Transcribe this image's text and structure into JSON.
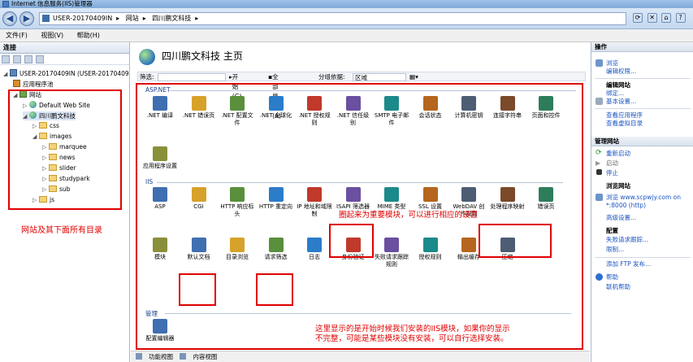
{
  "window": {
    "title": "Internet 信息服务(IIS)管理器"
  },
  "address": {
    "crumbs": [
      "USER-20170409IN",
      "网站",
      "四川鹏文科技"
    ]
  },
  "menu": [
    "文件(F)",
    "视图(V)",
    "帮助(H)"
  ],
  "left": {
    "header": "连接",
    "tree": {
      "server": "USER-20170409IN (USER-20170409",
      "app_pools": "应用程序池",
      "sites": "网站",
      "default_site": "Default Web Site",
      "site": "四川鹏文科技",
      "folders": [
        "css",
        "images",
        "marquee",
        "news",
        "slider",
        "studypark",
        "sub",
        "js"
      ]
    },
    "note": "网站及其下面所有目录"
  },
  "center": {
    "title": "四川鹏文科技 主页",
    "filter": {
      "label": "筛选:",
      "go": "开始(G)",
      "show_all": "全部显示(A)",
      "group_label": "分组依据:",
      "group_value": "区域"
    },
    "sections": {
      "aspnet": "ASP.NET",
      "iis": "IIS",
      "mgmt": "管理"
    },
    "aspnet_items": [
      ".NET 编译",
      ".NET 错误页",
      ".NET 配置文件",
      ".NET 全球化",
      ".NET 授权规则",
      ".NET 信任级别",
      "SMTP 电子邮件",
      "会话状态",
      "计算机密钥",
      "连接字符串",
      "页面和控件",
      "应用程序设置"
    ],
    "iis_items": [
      "ASP",
      "CGI",
      "HTTP 响应标头",
      "HTTP 重定向",
      "IP 地址和域限制",
      "ISAPI 筛选器",
      "MIME 类型",
      "SSL 设置",
      "WebDAV 创作规则",
      "处理程序映射",
      "错误页",
      "模块",
      "默认文档",
      "目录浏览",
      "请求筛选",
      "日志",
      "身份验证",
      "失败请求跟踪规则",
      "授权规则",
      "输出缓存",
      "压缩"
    ],
    "mgmt_items": [
      "配置编辑器"
    ],
    "note_important": "圈起来为重要模块，可以进行相应的设置",
    "note_bottom_1": "这里显示的是开始时候我们安装的IIS模块，如果你的显示",
    "note_bottom_2": "不完整，可能是某些模块没有安装，可以自行选择安装。",
    "tabs": [
      "功能视图",
      "内容视图"
    ]
  },
  "right": {
    "header": "操作",
    "browse": "浏览",
    "edit_perms": "编辑权限...",
    "edit_site": "编辑网站",
    "bindings": "绑定...",
    "basic": "基本设置...",
    "view_apps": "查看应用程序",
    "view_vdirs": "查看虚拟目录",
    "manage_site": "管理网站",
    "restart": "重新启动",
    "start": "启动",
    "stop": "停止",
    "browse_site": "浏览网站",
    "browse_link": "浏览 www.scpwjy.com on",
    "browse_port": "*:8000 (http)",
    "advanced": "高级设置...",
    "config": "配置",
    "failed_req": "失败请求跟踪...",
    "limits": "限制...",
    "ftp": "添加 FTP 发布...",
    "help": "帮助",
    "online_help": "联机帮助"
  }
}
